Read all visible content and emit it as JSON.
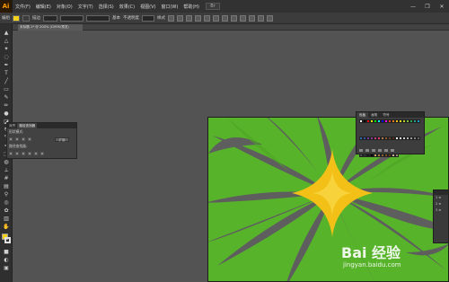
{
  "menubar": {
    "logo": "Ai",
    "items": [
      "文件(F)",
      "编辑(E)",
      "对象(O)",
      "文字(T)",
      "选择(S)",
      "效果(C)",
      "视图(V)",
      "窗口(W)",
      "帮助(H)"
    ],
    "bridge": "Br",
    "window_controls": [
      "—",
      "❐",
      "✕"
    ]
  },
  "controlbar": {
    "selection_label": "编组",
    "stroke_label": "描边",
    "style_label": "基本",
    "opacity_label": "不透明度",
    "style2_label": "样式"
  },
  "document": {
    "tab_label": "未标题-1* @ 200% (CMYK/预览)"
  },
  "tools_panel": {
    "tabs": [
      "对齐",
      "路径查找器"
    ],
    "row1_label": "形状模式:",
    "expand_button": "扩展",
    "row3_label": "路径查找器:"
  },
  "swatches_panel": {
    "tabs": [
      "色板",
      "画笔",
      "符号"
    ],
    "colors": [
      "#ffffff",
      "#000000",
      "#ff0000",
      "#ffff00",
      "#00ff00",
      "#00ffff",
      "#0000ff",
      "#ff00ff",
      "#e8402a",
      "#f07c1a",
      "#f7b71c",
      "#f5e61a",
      "#b8d433",
      "#7ac143",
      "#2ea84a",
      "#1f9e8e",
      "#1aa0c8",
      "#2b6db3",
      "#3d4ea0",
      "#6a3d98",
      "#8c3a8f",
      "#c23b86",
      "#e8396b",
      "#b07c4f",
      "#8a5a36",
      "#6a4428",
      "#4c2f1a",
      "#ffffff",
      "#e6e6e6",
      "#cccccc",
      "#b3b3b3",
      "#999999",
      "#808080",
      "#666666",
      "#4d4d4d",
      "#333333",
      "#1a1a1a",
      "#000000",
      "#c8a165",
      "#a67c52",
      "#8c6239",
      "#754c24",
      "#603913",
      "#c7b299",
      "#998675"
    ]
  },
  "right_panel": {
    "lines": [
      "1 ≡",
      "2 ≡",
      "3 ≡"
    ]
  },
  "watermark": {
    "logo": "Bai 经验",
    "url": "jingyan.baidu.com"
  },
  "colors": {
    "canvas": "#535353",
    "artboard_green": "#57b32a",
    "artboard_gray": "#5e5e5e",
    "star_yellow": "#f3c017",
    "fill_color": "#f3d31a"
  }
}
